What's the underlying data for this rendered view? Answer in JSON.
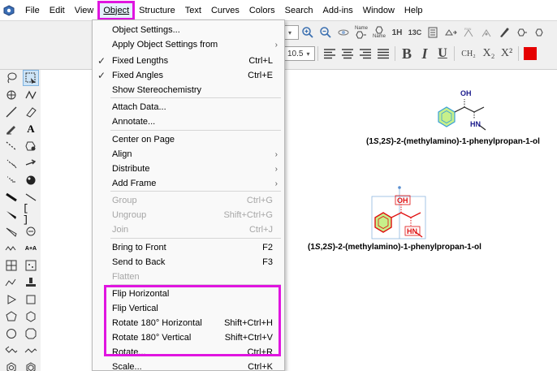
{
  "menubar": {
    "items": [
      {
        "label": "File",
        "active": false
      },
      {
        "label": "Edit",
        "active": false
      },
      {
        "label": "View",
        "active": false
      },
      {
        "label": "Object",
        "active": true
      },
      {
        "label": "Structure",
        "active": false
      },
      {
        "label": "Text",
        "active": false
      },
      {
        "label": "Curves",
        "active": false
      },
      {
        "label": "Colors",
        "active": false
      },
      {
        "label": "Search",
        "active": false
      },
      {
        "label": "Add-ins",
        "active": false
      },
      {
        "label": "Window",
        "active": false
      },
      {
        "label": "Help",
        "active": false
      }
    ]
  },
  "toolbar": {
    "font_size": "10.5",
    "bold": "B",
    "italic": "I",
    "underline": "U",
    "subscript_formula": "CH₂",
    "subscript": "X₂",
    "superscript": "X²",
    "color_swatch": "#e50000",
    "nmr_h": "1H",
    "nmr_c": "13C",
    "name_label_1": "Name",
    "name_label_2": "Name"
  },
  "object_menu": {
    "items": [
      {
        "label": "Object Settings...",
        "shortcut": "",
        "checked": false,
        "disabled": false,
        "submenu": false
      },
      {
        "label": "Apply Object Settings from",
        "shortcut": "",
        "checked": false,
        "disabled": false,
        "submenu": true
      },
      {
        "label": "Fixed Lengths",
        "shortcut": "Ctrl+L",
        "checked": true,
        "disabled": false,
        "submenu": false
      },
      {
        "label": "Fixed Angles",
        "shortcut": "Ctrl+E",
        "checked": true,
        "disabled": false,
        "submenu": false
      },
      {
        "label": "Show Stereochemistry",
        "shortcut": "",
        "checked": false,
        "disabled": false,
        "submenu": false
      },
      {
        "label": "Attach Data...",
        "shortcut": "",
        "checked": false,
        "disabled": false,
        "submenu": false
      },
      {
        "label": "Annotate...",
        "shortcut": "",
        "checked": false,
        "disabled": false,
        "submenu": false
      },
      {
        "label": "Center on Page",
        "shortcut": "",
        "checked": false,
        "disabled": false,
        "submenu": false
      },
      {
        "label": "Align",
        "shortcut": "",
        "checked": false,
        "disabled": false,
        "submenu": true
      },
      {
        "label": "Distribute",
        "shortcut": "",
        "checked": false,
        "disabled": false,
        "submenu": true
      },
      {
        "label": "Add Frame",
        "shortcut": "",
        "checked": false,
        "disabled": false,
        "submenu": true
      },
      {
        "label": "Group",
        "shortcut": "Ctrl+G",
        "checked": false,
        "disabled": true,
        "submenu": false
      },
      {
        "label": "Ungroup",
        "shortcut": "Shift+Ctrl+G",
        "checked": false,
        "disabled": true,
        "submenu": false
      },
      {
        "label": "Join",
        "shortcut": "Ctrl+J",
        "checked": false,
        "disabled": true,
        "submenu": false
      },
      {
        "label": "Bring to Front",
        "shortcut": "F2",
        "checked": false,
        "disabled": false,
        "submenu": false
      },
      {
        "label": "Send to Back",
        "shortcut": "F3",
        "checked": false,
        "disabled": false,
        "submenu": false
      },
      {
        "label": "Flatten",
        "shortcut": "",
        "checked": false,
        "disabled": true,
        "submenu": false
      },
      {
        "label": "Flip Horizontal",
        "shortcut": "",
        "checked": false,
        "disabled": false,
        "submenu": false
      },
      {
        "label": "Flip Vertical",
        "shortcut": "",
        "checked": false,
        "disabled": false,
        "submenu": false
      },
      {
        "label": "Rotate 180° Horizontal",
        "shortcut": "Shift+Ctrl+H",
        "checked": false,
        "disabled": false,
        "submenu": false
      },
      {
        "label": "Rotate 180° Vertical",
        "shortcut": "Shift+Ctrl+V",
        "checked": false,
        "disabled": false,
        "submenu": false
      },
      {
        "label": "Rotate...",
        "shortcut": "Ctrl+R",
        "checked": false,
        "disabled": false,
        "submenu": false
      },
      {
        "label": "Scale...",
        "shortcut": "Ctrl+K",
        "checked": false,
        "disabled": false,
        "submenu": false
      }
    ],
    "check_glyph": "✓",
    "submenu_glyph": "›"
  },
  "canvas": {
    "molecule_top": {
      "atom_oh": "OH",
      "atom_hn": "HN",
      "caption_prefix": "(1",
      "caption_s1": "S",
      "caption_mid": ",2",
      "caption_s2": "S",
      "caption_suffix": ")-2-(methylamino)-1-phenylpropan-1-ol"
    },
    "molecule_bottom": {
      "atom_oh": "OH",
      "atom_hn": "HN",
      "caption_prefix": "(1",
      "caption_s1": "S",
      "caption_mid": ",2",
      "caption_s2": "S",
      "caption_suffix": ")-2-(methylamino)-1-phenylpropan-1-ol"
    },
    "ring_fill_color": "#c7f08a",
    "ring_stroke_color": "#3aa0d8",
    "hetero_color": "#1a1a8c",
    "selection_color": "#e01010"
  },
  "highlight_color": "#e015e0"
}
